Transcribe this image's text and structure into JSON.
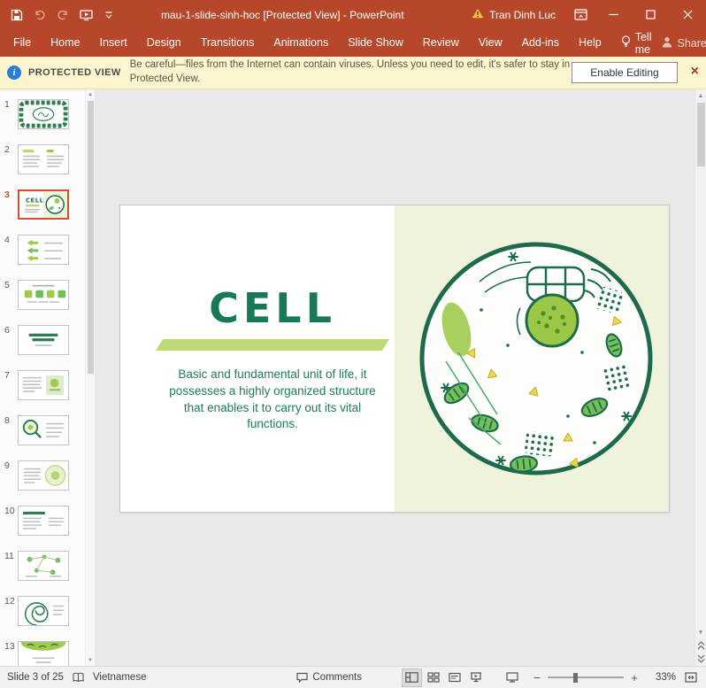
{
  "colors": {
    "titlebar_red": "#b7472a",
    "banner_yellow": "#fdf5cf",
    "slide_green": "#17795a",
    "underline_green": "#bcd877",
    "slide_panel_bg": "#eff3db",
    "selected_thumb_border": "#d0512b"
  },
  "titlebar": {
    "title": "mau-1-slide-sinh-hoc [Protected View]  -  PowerPoint",
    "user": "Tran Dinh Luc"
  },
  "menu": {
    "tabs": [
      "File",
      "Home",
      "Insert",
      "Design",
      "Transitions",
      "Animations",
      "Slide Show",
      "Review",
      "View",
      "Add-ins",
      "Help"
    ],
    "tell_me": "Tell me",
    "share": "Share"
  },
  "banner": {
    "label": "PROTECTED VIEW",
    "message": "Be careful—files from the Internet can contain viruses. Unless you need to edit, it's safer to stay in Protected View.",
    "button": "Enable Editing"
  },
  "thumbnails": [
    {
      "num": "1",
      "kind": "cover",
      "selected": false
    },
    {
      "num": "2",
      "kind": "toc",
      "selected": false
    },
    {
      "num": "3",
      "kind": "cell",
      "selected": true
    },
    {
      "num": "4",
      "kind": "flow",
      "selected": false
    },
    {
      "num": "5",
      "kind": "icons-row",
      "selected": false
    },
    {
      "num": "6",
      "kind": "title-text",
      "selected": false
    },
    {
      "num": "7",
      "kind": "text-image",
      "selected": false
    },
    {
      "num": "8",
      "kind": "magnifier",
      "selected": false
    },
    {
      "num": "9",
      "kind": "text-circle",
      "selected": false
    },
    {
      "num": "10",
      "kind": "protein",
      "selected": false
    },
    {
      "num": "11",
      "kind": "diagram",
      "selected": false
    },
    {
      "num": "12",
      "kind": "spiral",
      "selected": false
    },
    {
      "num": "13",
      "kind": "leafy",
      "selected": false
    }
  ],
  "slide": {
    "title": "CELL",
    "body": "Basic and fundamental unit of life, it possesses a highly organized structure that enables it to carry out its vital functions."
  },
  "statusbar": {
    "slide_info": "Slide 3 of 25",
    "language": "Vietnamese",
    "comments": "Comments",
    "zoom": "33%",
    "views": [
      "normal-view",
      "slide-sorter-view",
      "reading-view",
      "slide-show-view"
    ]
  },
  "icons": {
    "quick_access": [
      "save",
      "undo",
      "redo",
      "start-from-beginning",
      "customize-quick-access"
    ],
    "window": [
      "minimize",
      "maximize",
      "close"
    ],
    "status": [
      "spellcheck",
      "comments",
      "normal-view",
      "slide-sorter",
      "reading-view",
      "slide-show",
      "monitor",
      "zoom-out",
      "zoom-in",
      "fit-to-window"
    ]
  }
}
